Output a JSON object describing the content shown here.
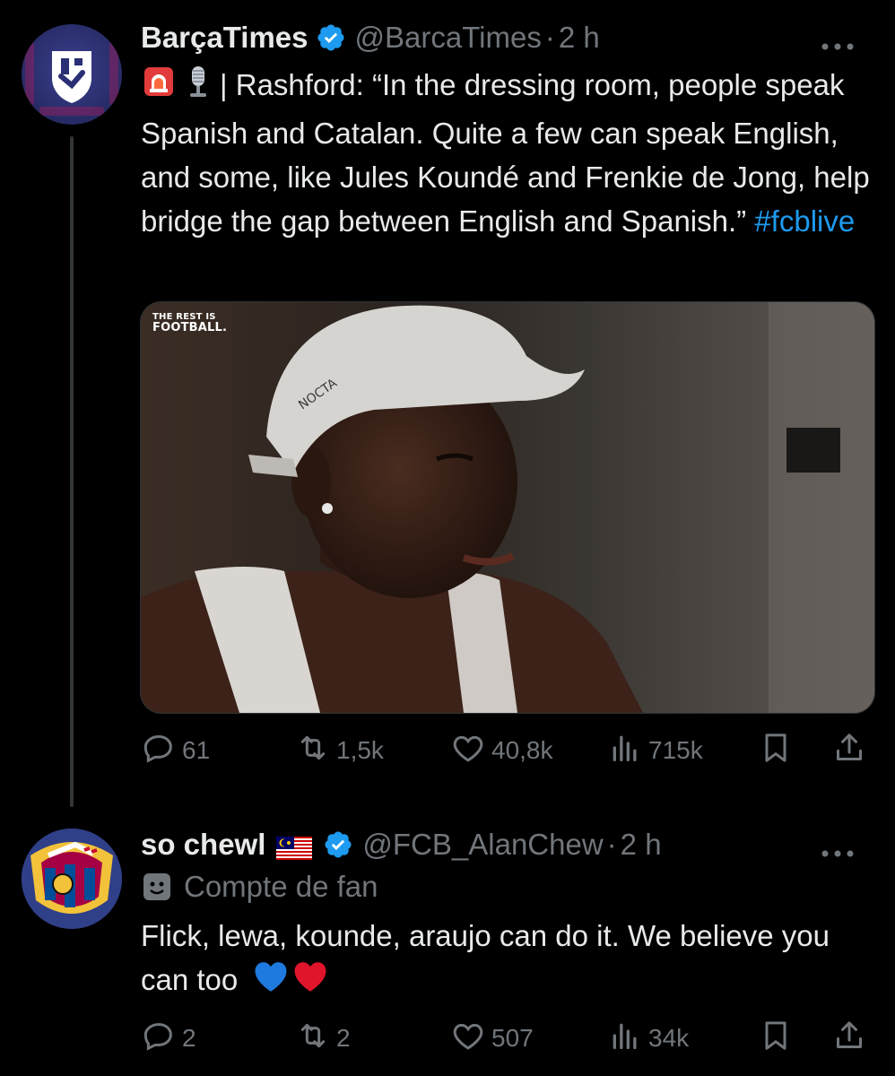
{
  "tweet1": {
    "display_name": "BarçaTimes",
    "handle": "@BarcaTimes",
    "separator": "·",
    "time": "2 h",
    "text_prefix": "| Rashford: “In the dressing room, people speak Spanish and Catalan. Quite a few can speak English, and some, like Jules Koundé and Frenkie de Jong, help bridge the gap between English and Spanish.”",
    "hashtag": "#fcblive",
    "media_logo_line1": "THE REST IS",
    "media_logo_line2": "FOOTBALL.",
    "cap_brand": "NOCTA",
    "replies": "61",
    "retweets": "1,5k",
    "likes": "40,8k",
    "views": "715k"
  },
  "tweet2": {
    "display_name": "so chewl",
    "handle": "@FCB_AlanChew",
    "separator": "·",
    "time": "2 h",
    "fan_label": "Compte de fan",
    "text": "Flick, lewa, kounde, araujo can do it. We believe you can too",
    "replies": "2",
    "retweets": "2",
    "likes": "507",
    "views": "34k"
  },
  "icons": {
    "verified": "verified-badge-icon",
    "more": "more-icon",
    "reply": "reply-icon",
    "retweet": "retweet-icon",
    "like": "heart-icon",
    "views": "views-icon",
    "bookmark": "bookmark-icon",
    "share": "share-icon"
  },
  "colors": {
    "background": "#000000",
    "text": "#e7e9ea",
    "secondary": "#71767b",
    "link": "#1d9bf0",
    "verified": "#1d9bf0"
  }
}
